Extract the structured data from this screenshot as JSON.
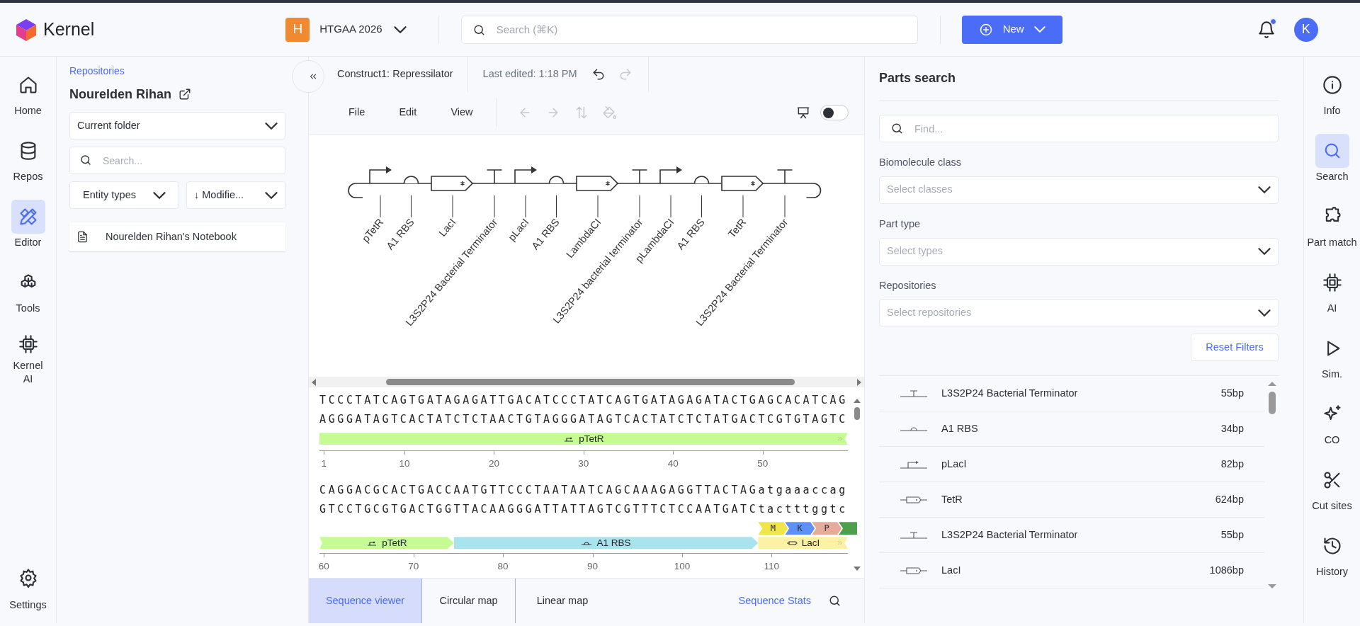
{
  "header": {
    "brand": "Kernel",
    "workspace": {
      "initial": "H",
      "name": "HTGAA 2026"
    },
    "search": {
      "placeholder": "Search (⌘K)"
    },
    "new_button": "New",
    "notifications": {
      "unread": true
    },
    "avatar": "K"
  },
  "nav": [
    {
      "label": "Home",
      "selected": false
    },
    {
      "label": "Repos",
      "selected": false
    },
    {
      "label": "Editor",
      "selected": true
    },
    {
      "label": "Tools",
      "selected": false
    },
    {
      "label": "Kernel AI",
      "selected": false
    }
  ],
  "nav_bottom": {
    "label": "Settings"
  },
  "folder_panel": {
    "breadcrumb": "Repositories",
    "title": "Nourelden Rihan",
    "location": "Current folder",
    "search": {
      "placeholder": "Search..."
    },
    "filters": [
      "Entity types",
      "↓ Modifie..."
    ],
    "entries": [
      {
        "label": "Nourelden Rihan's Notebook"
      }
    ]
  },
  "editor": {
    "title": "Construct1: Repressilator",
    "last_edited": "Last edited: 1:18 PM",
    "history": [
      {
        "disabled": false
      },
      {
        "disabled": true
      }
    ],
    "menus": [
      "File",
      "Edit",
      "View"
    ],
    "tools": [
      {
        "disabled": true
      },
      {
        "disabled": true
      },
      {
        "disabled": true
      },
      {
        "disabled": true
      }
    ],
    "presentation_toggle": {
      "on": false
    },
    "construct": [
      {
        "kind": "promoter",
        "label": "pTetR"
      },
      {
        "kind": "rbs",
        "label": "A1 RBS"
      },
      {
        "kind": "cds",
        "label": "LacI"
      },
      {
        "kind": "terminator",
        "label": "L3S2P24 Bacterial Terminator"
      },
      {
        "kind": "promoter",
        "label": "pLacI"
      },
      {
        "kind": "rbs",
        "label": "A1 RBS"
      },
      {
        "kind": "cds",
        "label": "LambdaCI"
      },
      {
        "kind": "terminator",
        "label": "L3S2P24 bacterial terminator"
      },
      {
        "kind": "promoter",
        "label": "pLambdaCI"
      },
      {
        "kind": "rbs",
        "label": "A1 RBS"
      },
      {
        "kind": "cds",
        "label": "TetR"
      },
      {
        "kind": "terminator",
        "label": "L3S2P24 Bacterial Terminator"
      }
    ],
    "sequence_rows": [
      {
        "top": "TCCCTATCAGTGATAGAGATTGACATCCCTATCAGTGATAGAGATACTGAGCACATCAG",
        "bottom": "AGGGATAGTCACTATCTCTAACTGTAGGGATAGTCACTATCTCTATGACTCGTGTAGTC",
        "features": [
          {
            "kind": "promoter",
            "label": "pTetR",
            "color": "#c6fb93",
            "continues_left": false,
            "continues_right": true
          }
        ],
        "ticks": [
          "1",
          "10",
          "20",
          "30",
          "40",
          "50"
        ]
      },
      {
        "top": "CAGGACGCACTGACCAATGTTCCCTAATAATCAGCAAAGAGGTTACTAGatgaaaccag",
        "bottom": "GTCCTGCGTGACTGGTTACAAGGGATTATTAGTCGTTTCTCCAATGATCtactttggtc",
        "translation": [
          {
            "residue": "M",
            "color": "#f0e64c"
          },
          {
            "residue": "K",
            "color": "#5f8ff8"
          },
          {
            "residue": "P",
            "color": "#e7ab9c"
          },
          {
            "color": "#4c9f4c"
          }
        ],
        "features": [
          {
            "kind": "promoter",
            "label": "pTetR",
            "color": "#c6fb93",
            "continues_left": true,
            "continues_right": false
          },
          {
            "kind": "rbs",
            "label": "A1 RBS",
            "color": "#a9e4ee",
            "continues_left": false,
            "continues_right": false
          },
          {
            "kind": "cds",
            "label": "LacI",
            "color": "#fdf1a4",
            "continues_left": false,
            "continues_right": true
          }
        ],
        "ticks": [
          "60",
          "70",
          "80",
          "90",
          "100",
          "110"
        ]
      }
    ],
    "view_tabs": [
      {
        "label": "Sequence viewer",
        "selected": true
      },
      {
        "label": "Circular map",
        "selected": false
      },
      {
        "label": "Linear map",
        "selected": false
      }
    ],
    "stats_link": "Sequence Stats"
  },
  "parts_search": {
    "title": "Parts search",
    "search": {
      "placeholder": "Find..."
    },
    "filters": [
      {
        "label": "Biomolecule class",
        "placeholder": "Select classes"
      },
      {
        "label": "Part type",
        "placeholder": "Select types"
      },
      {
        "label": "Repositories",
        "placeholder": "Select repositories"
      }
    ],
    "reset": "Reset Filters",
    "results": [
      {
        "kind": "terminator",
        "name": "L3S2P24 Bacterial Terminator",
        "length": "55bp"
      },
      {
        "kind": "rbs",
        "name": "A1 RBS",
        "length": "34bp"
      },
      {
        "kind": "promoter",
        "name": "pLacI",
        "length": "82bp"
      },
      {
        "kind": "cds",
        "name": "TetR",
        "length": "624bp"
      },
      {
        "kind": "terminator",
        "name": "L3S2P24 Bacterial Terminator",
        "length": "55bp"
      },
      {
        "kind": "cds",
        "name": "LacI",
        "length": "1086bp"
      }
    ]
  },
  "right_nav": [
    {
      "label": "Info",
      "selected": false
    },
    {
      "label": "Search",
      "selected": true
    },
    {
      "label": "Part match",
      "selected": false
    },
    {
      "label": "AI",
      "selected": false
    },
    {
      "label": "Sim.",
      "selected": false
    },
    {
      "label": "CO",
      "selected": false
    },
    {
      "label": "Cut sites",
      "selected": false
    },
    {
      "label": "History",
      "selected": false
    }
  ]
}
